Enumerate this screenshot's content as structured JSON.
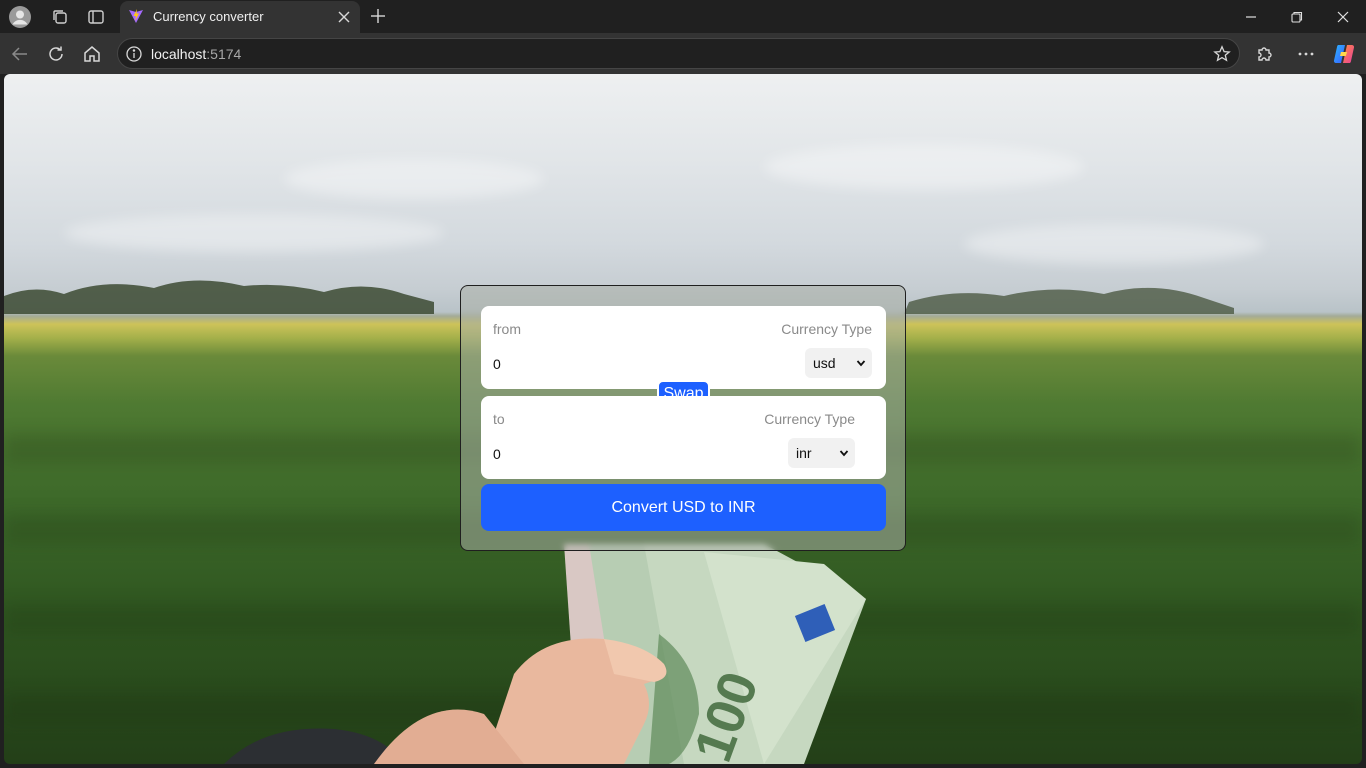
{
  "browser": {
    "tab_title": "Currency converter",
    "url_host": "localhost",
    "url_port": ":5174",
    "icons": {
      "profile": "profile-icon",
      "workspaces": "workspaces-icon",
      "tab_actions": "tab-actions-icon",
      "close_tab": "close-icon",
      "new_tab": "plus-icon",
      "back": "back-arrow-icon",
      "reload": "reload-icon",
      "home": "home-icon",
      "site_info": "info-icon",
      "favorite": "star-icon",
      "extensions": "puzzle-icon",
      "menu": "more-icon",
      "copilot": "copilot-icon"
    }
  },
  "converter": {
    "from": {
      "label": "from",
      "currency_label": "Currency Type",
      "amount": "0",
      "currency": "usd"
    },
    "to": {
      "label": "to",
      "currency_label": "Currency Type",
      "amount": "0",
      "currency": "inr"
    },
    "swap_label": "Swap",
    "convert_label": "Convert USD to INR",
    "colors": {
      "accent": "#1d60ff",
      "panel": "#ffffff",
      "label": "#8a8a8a"
    }
  }
}
